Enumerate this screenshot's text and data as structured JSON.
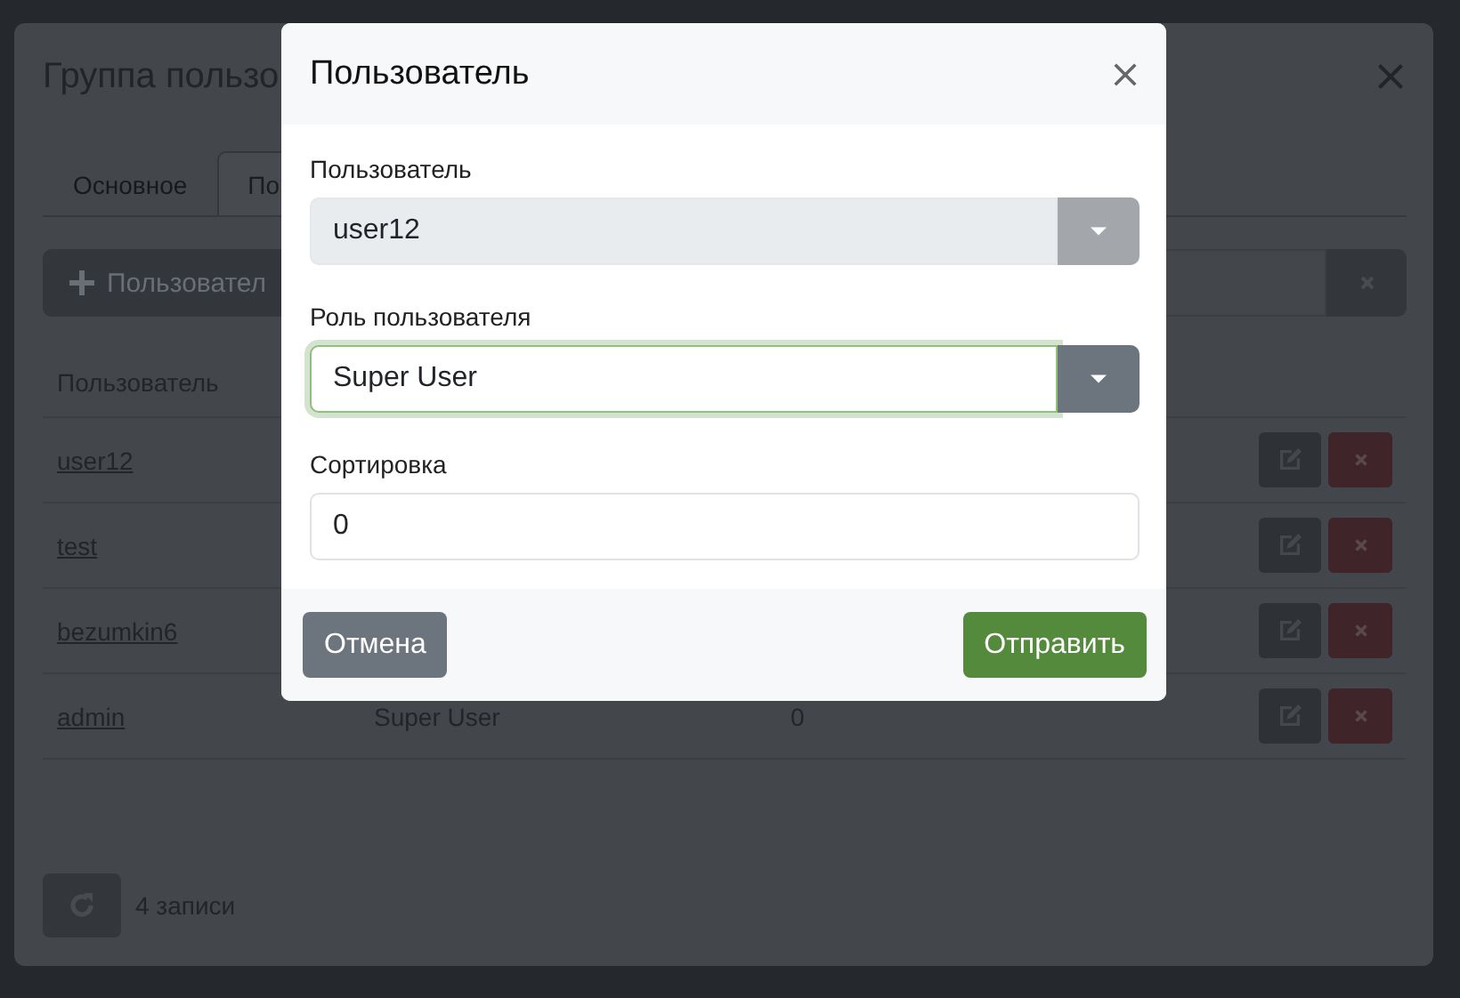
{
  "background_dialog": {
    "title": "Группа пользо",
    "tabs": [
      {
        "label": "Основное",
        "selected": false
      },
      {
        "label": "По",
        "selected": true
      }
    ],
    "toolbar": {
      "add_button": "Пользовател"
    },
    "table": {
      "columns": [
        "Пользователь"
      ],
      "rows": [
        {
          "cells": [
            "user12"
          ]
        },
        {
          "cells": [
            "test"
          ]
        },
        {
          "cells": [
            "bezumkin6"
          ]
        },
        {
          "cells": [
            "admin",
            "Super User",
            "0"
          ]
        }
      ]
    },
    "footer": {
      "count": "4 записи"
    }
  },
  "dialog": {
    "title": "Пользователь",
    "fields": [
      {
        "kind": "select",
        "label": "Пользователь",
        "value": "user12",
        "disabled": true,
        "focused": false
      },
      {
        "kind": "select",
        "label": "Роль пользователя",
        "value": "Super User",
        "disabled": false,
        "focused": true
      },
      {
        "kind": "input",
        "label": "Сортировка",
        "value": "0",
        "disabled": false,
        "focused": false
      }
    ],
    "buttons": [
      {
        "label": "Отмена",
        "kind": "secondary"
      },
      {
        "label": "Отправить",
        "kind": "primary"
      }
    ]
  }
}
